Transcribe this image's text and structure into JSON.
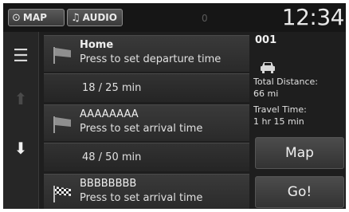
{
  "statusbar": {
    "map_label": "MAP",
    "audio_label": "AUDIO",
    "indicator": "0",
    "clock": "12:34"
  },
  "route": {
    "stops": [
      {
        "title": "Home",
        "subtitle": "Press to set departure time",
        "flag": "start-flag-icon"
      },
      {
        "title": "AAAAAAAA",
        "subtitle": "Press to set arrival time",
        "flag": "waypoint-flag-icon"
      },
      {
        "title": "BBBBBBBB",
        "subtitle": "Press to set arrival time",
        "flag": "finish-flag-icon"
      }
    ],
    "segments": [
      {
        "text": "18 / 25 min"
      },
      {
        "text": "48 / 50 min"
      }
    ]
  },
  "summary": {
    "route_id": "001",
    "distance_label": "Total Distance:",
    "distance_value": "66 mi",
    "time_label": "Travel Time:",
    "time_value": "1 hr 15 min"
  },
  "buttons": {
    "map_label": "Map",
    "go_label": "Go!"
  },
  "icons": {
    "menu": "menu-icon",
    "scroll_up": "arrow-up-icon",
    "scroll_down": "arrow-down-icon",
    "car": "car-icon"
  }
}
